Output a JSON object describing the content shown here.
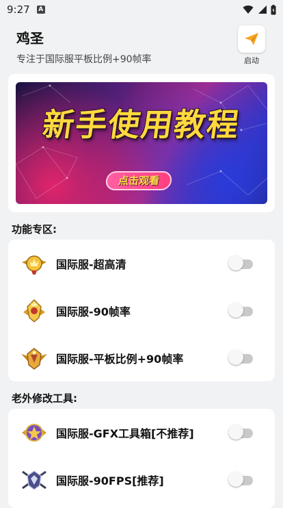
{
  "status_bar": {
    "time": "9:27",
    "notification_icon": "a-icon"
  },
  "header": {
    "title": "鸡圣",
    "subtitle": "专注于国际服平板比例+90帧率",
    "start_button_label": "启动",
    "start_icon": "paper-plane-icon"
  },
  "banner": {
    "title": "新手使用教程",
    "button_label": "点击观看"
  },
  "features": {
    "title": "功能专区:",
    "items": [
      {
        "label": "国际服-超高清",
        "enabled": false,
        "icon": "gold-badge-icon"
      },
      {
        "label": "国际服-90帧率",
        "enabled": false,
        "icon": "crown-emblem-icon"
      },
      {
        "label": "国际服-平板比例+90帧率",
        "enabled": false,
        "icon": "winged-emblem-icon"
      }
    ]
  },
  "tools": {
    "title": "老外修改工具:",
    "items": [
      {
        "label": "国际服-GFX工具箱[不推荐]",
        "enabled": false,
        "icon": "purple-gold-emblem-icon"
      },
      {
        "label": "国际服-90FPS[推荐]",
        "enabled": false,
        "icon": "crossed-guns-emblem-icon"
      }
    ]
  },
  "colors": {
    "background": "#f1f2f4",
    "toggle_off_track": "#c9c9cb",
    "banner_title": "#ffd93d",
    "start_icon": "#f5a623"
  }
}
